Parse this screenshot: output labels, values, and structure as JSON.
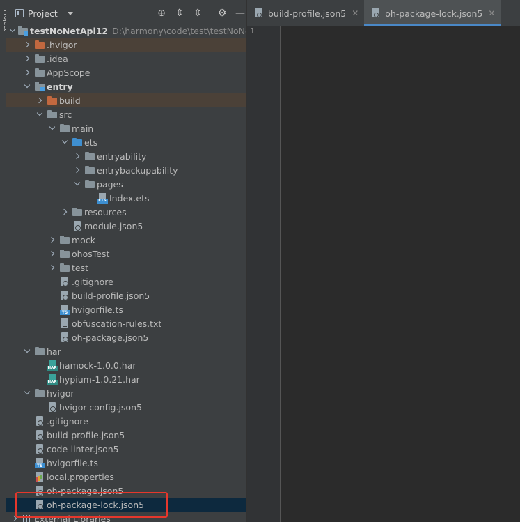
{
  "side_strip": {
    "label": "Project"
  },
  "panel": {
    "title": "Project",
    "tools": [
      {
        "name": "locate-icon",
        "glyph": "⊕"
      },
      {
        "name": "expand-all-icon",
        "glyph": "⇕"
      },
      {
        "name": "collapse-all-icon",
        "glyph": "⇳"
      },
      {
        "name": "settings-icon",
        "glyph": "⚙"
      },
      {
        "name": "hide-icon",
        "glyph": "—"
      }
    ]
  },
  "tree": [
    {
      "label": "testNoNetApi12",
      "path": "D:\\harmony\\code\\test\\testNoNetA",
      "depth": 0,
      "arrow": "expanded",
      "icon": "module",
      "bold": true
    },
    {
      "label": ".hvigor",
      "depth": 1,
      "arrow": "collapsed",
      "icon": "folder-orange",
      "excluded": true
    },
    {
      "label": ".idea",
      "depth": 1,
      "arrow": "collapsed",
      "icon": "folder"
    },
    {
      "label": "AppScope",
      "depth": 1,
      "arrow": "collapsed",
      "icon": "folder"
    },
    {
      "label": "entry",
      "depth": 1,
      "arrow": "expanded",
      "icon": "module",
      "bold": true
    },
    {
      "label": "build",
      "depth": 2,
      "arrow": "collapsed",
      "icon": "folder-orange",
      "excluded": true
    },
    {
      "label": "src",
      "depth": 2,
      "arrow": "expanded",
      "icon": "folder"
    },
    {
      "label": "main",
      "depth": 3,
      "arrow": "expanded",
      "icon": "folder"
    },
    {
      "label": "ets",
      "depth": 4,
      "arrow": "expanded",
      "icon": "folder-blue"
    },
    {
      "label": "entryability",
      "depth": 5,
      "arrow": "collapsed",
      "icon": "folder"
    },
    {
      "label": "entrybackupability",
      "depth": 5,
      "arrow": "collapsed",
      "icon": "folder"
    },
    {
      "label": "pages",
      "depth": 5,
      "arrow": "expanded",
      "icon": "folder"
    },
    {
      "label": "Index.ets",
      "depth": 6,
      "arrow": "none",
      "icon": "ets"
    },
    {
      "label": "resources",
      "depth": 4,
      "arrow": "collapsed",
      "icon": "folder"
    },
    {
      "label": "module.json5",
      "depth": 4,
      "arrow": "none",
      "icon": "json"
    },
    {
      "label": "mock",
      "depth": 3,
      "arrow": "collapsed",
      "icon": "folder"
    },
    {
      "label": "ohosTest",
      "depth": 3,
      "arrow": "collapsed",
      "icon": "folder"
    },
    {
      "label": "test",
      "depth": 3,
      "arrow": "collapsed",
      "icon": "folder"
    },
    {
      "label": ".gitignore",
      "depth": 3,
      "arrow": "none",
      "icon": "json"
    },
    {
      "label": "build-profile.json5",
      "depth": 3,
      "arrow": "none",
      "icon": "json"
    },
    {
      "label": "hvigorfile.ts",
      "depth": 3,
      "arrow": "none",
      "icon": "ts"
    },
    {
      "label": "obfuscation-rules.txt",
      "depth": 3,
      "arrow": "none",
      "icon": "txt"
    },
    {
      "label": "oh-package.json5",
      "depth": 3,
      "arrow": "none",
      "icon": "json"
    },
    {
      "label": "har",
      "depth": 1,
      "arrow": "expanded",
      "icon": "folder"
    },
    {
      "label": "hamock-1.0.0.har",
      "depth": 2,
      "arrow": "none",
      "icon": "har"
    },
    {
      "label": "hypium-1.0.21.har",
      "depth": 2,
      "arrow": "none",
      "icon": "har"
    },
    {
      "label": "hvigor",
      "depth": 1,
      "arrow": "expanded",
      "icon": "folder"
    },
    {
      "label": "hvigor-config.json5",
      "depth": 2,
      "arrow": "none",
      "icon": "json"
    },
    {
      "label": ".gitignore",
      "depth": 1,
      "arrow": "none",
      "icon": "json"
    },
    {
      "label": "build-profile.json5",
      "depth": 1,
      "arrow": "none",
      "icon": "json"
    },
    {
      "label": "code-linter.json5",
      "depth": 1,
      "arrow": "none",
      "icon": "json"
    },
    {
      "label": "hvigorfile.ts",
      "depth": 1,
      "arrow": "none",
      "icon": "ts"
    },
    {
      "label": "local.properties",
      "depth": 1,
      "arrow": "none",
      "icon": "props"
    },
    {
      "label": "oh-package.json5",
      "depth": 1,
      "arrow": "none",
      "icon": "json"
    },
    {
      "label": "oh-package-lock.json5",
      "depth": 1,
      "arrow": "none",
      "icon": "json",
      "selected": true
    },
    {
      "label": "External Libraries",
      "depth": 0,
      "arrow": "collapsed",
      "icon": "lib"
    }
  ],
  "editor": {
    "tabs": [
      {
        "label": "build-profile.json5",
        "active": false
      },
      {
        "label": "oh-package-lock.json5",
        "active": true
      }
    ],
    "line_numbers": [
      "1"
    ]
  },
  "colors": {
    "panel_bg": "#3c3f41",
    "editor_bg": "#2b2b2b",
    "selection": "#0d293e",
    "excluded": "#4b4138",
    "highlight_box": "#e5372c",
    "active_tab_underline": "#4a88c7"
  }
}
